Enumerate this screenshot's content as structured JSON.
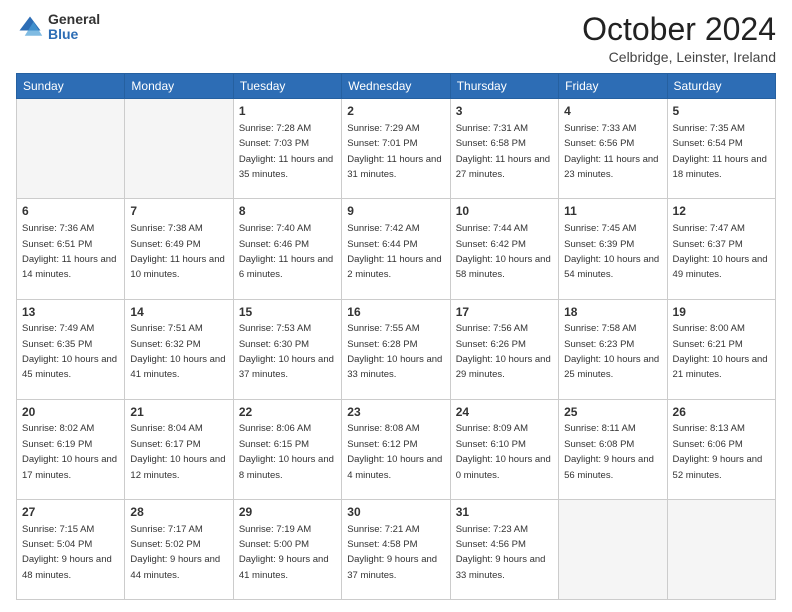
{
  "logo": {
    "general": "General",
    "blue": "Blue"
  },
  "header": {
    "month": "October 2024",
    "location": "Celbridge, Leinster, Ireland"
  },
  "weekdays": [
    "Sunday",
    "Monday",
    "Tuesday",
    "Wednesday",
    "Thursday",
    "Friday",
    "Saturday"
  ],
  "weeks": [
    [
      {
        "day": "",
        "empty": true
      },
      {
        "day": "",
        "empty": true
      },
      {
        "day": "1",
        "sunrise": "Sunrise: 7:28 AM",
        "sunset": "Sunset: 7:03 PM",
        "daylight": "Daylight: 11 hours and 35 minutes."
      },
      {
        "day": "2",
        "sunrise": "Sunrise: 7:29 AM",
        "sunset": "Sunset: 7:01 PM",
        "daylight": "Daylight: 11 hours and 31 minutes."
      },
      {
        "day": "3",
        "sunrise": "Sunrise: 7:31 AM",
        "sunset": "Sunset: 6:58 PM",
        "daylight": "Daylight: 11 hours and 27 minutes."
      },
      {
        "day": "4",
        "sunrise": "Sunrise: 7:33 AM",
        "sunset": "Sunset: 6:56 PM",
        "daylight": "Daylight: 11 hours and 23 minutes."
      },
      {
        "day": "5",
        "sunrise": "Sunrise: 7:35 AM",
        "sunset": "Sunset: 6:54 PM",
        "daylight": "Daylight: 11 hours and 18 minutes."
      }
    ],
    [
      {
        "day": "6",
        "sunrise": "Sunrise: 7:36 AM",
        "sunset": "Sunset: 6:51 PM",
        "daylight": "Daylight: 11 hours and 14 minutes."
      },
      {
        "day": "7",
        "sunrise": "Sunrise: 7:38 AM",
        "sunset": "Sunset: 6:49 PM",
        "daylight": "Daylight: 11 hours and 10 minutes."
      },
      {
        "day": "8",
        "sunrise": "Sunrise: 7:40 AM",
        "sunset": "Sunset: 6:46 PM",
        "daylight": "Daylight: 11 hours and 6 minutes."
      },
      {
        "day": "9",
        "sunrise": "Sunrise: 7:42 AM",
        "sunset": "Sunset: 6:44 PM",
        "daylight": "Daylight: 11 hours and 2 minutes."
      },
      {
        "day": "10",
        "sunrise": "Sunrise: 7:44 AM",
        "sunset": "Sunset: 6:42 PM",
        "daylight": "Daylight: 10 hours and 58 minutes."
      },
      {
        "day": "11",
        "sunrise": "Sunrise: 7:45 AM",
        "sunset": "Sunset: 6:39 PM",
        "daylight": "Daylight: 10 hours and 54 minutes."
      },
      {
        "day": "12",
        "sunrise": "Sunrise: 7:47 AM",
        "sunset": "Sunset: 6:37 PM",
        "daylight": "Daylight: 10 hours and 49 minutes."
      }
    ],
    [
      {
        "day": "13",
        "sunrise": "Sunrise: 7:49 AM",
        "sunset": "Sunset: 6:35 PM",
        "daylight": "Daylight: 10 hours and 45 minutes."
      },
      {
        "day": "14",
        "sunrise": "Sunrise: 7:51 AM",
        "sunset": "Sunset: 6:32 PM",
        "daylight": "Daylight: 10 hours and 41 minutes."
      },
      {
        "day": "15",
        "sunrise": "Sunrise: 7:53 AM",
        "sunset": "Sunset: 6:30 PM",
        "daylight": "Daylight: 10 hours and 37 minutes."
      },
      {
        "day": "16",
        "sunrise": "Sunrise: 7:55 AM",
        "sunset": "Sunset: 6:28 PM",
        "daylight": "Daylight: 10 hours and 33 minutes."
      },
      {
        "day": "17",
        "sunrise": "Sunrise: 7:56 AM",
        "sunset": "Sunset: 6:26 PM",
        "daylight": "Daylight: 10 hours and 29 minutes."
      },
      {
        "day": "18",
        "sunrise": "Sunrise: 7:58 AM",
        "sunset": "Sunset: 6:23 PM",
        "daylight": "Daylight: 10 hours and 25 minutes."
      },
      {
        "day": "19",
        "sunrise": "Sunrise: 8:00 AM",
        "sunset": "Sunset: 6:21 PM",
        "daylight": "Daylight: 10 hours and 21 minutes."
      }
    ],
    [
      {
        "day": "20",
        "sunrise": "Sunrise: 8:02 AM",
        "sunset": "Sunset: 6:19 PM",
        "daylight": "Daylight: 10 hours and 17 minutes."
      },
      {
        "day": "21",
        "sunrise": "Sunrise: 8:04 AM",
        "sunset": "Sunset: 6:17 PM",
        "daylight": "Daylight: 10 hours and 12 minutes."
      },
      {
        "day": "22",
        "sunrise": "Sunrise: 8:06 AM",
        "sunset": "Sunset: 6:15 PM",
        "daylight": "Daylight: 10 hours and 8 minutes."
      },
      {
        "day": "23",
        "sunrise": "Sunrise: 8:08 AM",
        "sunset": "Sunset: 6:12 PM",
        "daylight": "Daylight: 10 hours and 4 minutes."
      },
      {
        "day": "24",
        "sunrise": "Sunrise: 8:09 AM",
        "sunset": "Sunset: 6:10 PM",
        "daylight": "Daylight: 10 hours and 0 minutes."
      },
      {
        "day": "25",
        "sunrise": "Sunrise: 8:11 AM",
        "sunset": "Sunset: 6:08 PM",
        "daylight": "Daylight: 9 hours and 56 minutes."
      },
      {
        "day": "26",
        "sunrise": "Sunrise: 8:13 AM",
        "sunset": "Sunset: 6:06 PM",
        "daylight": "Daylight: 9 hours and 52 minutes."
      }
    ],
    [
      {
        "day": "27",
        "sunrise": "Sunrise: 7:15 AM",
        "sunset": "Sunset: 5:04 PM",
        "daylight": "Daylight: 9 hours and 48 minutes."
      },
      {
        "day": "28",
        "sunrise": "Sunrise: 7:17 AM",
        "sunset": "Sunset: 5:02 PM",
        "daylight": "Daylight: 9 hours and 44 minutes."
      },
      {
        "day": "29",
        "sunrise": "Sunrise: 7:19 AM",
        "sunset": "Sunset: 5:00 PM",
        "daylight": "Daylight: 9 hours and 41 minutes."
      },
      {
        "day": "30",
        "sunrise": "Sunrise: 7:21 AM",
        "sunset": "Sunset: 4:58 PM",
        "daylight": "Daylight: 9 hours and 37 minutes."
      },
      {
        "day": "31",
        "sunrise": "Sunrise: 7:23 AM",
        "sunset": "Sunset: 4:56 PM",
        "daylight": "Daylight: 9 hours and 33 minutes."
      },
      {
        "day": "",
        "empty": true
      },
      {
        "day": "",
        "empty": true
      }
    ]
  ]
}
